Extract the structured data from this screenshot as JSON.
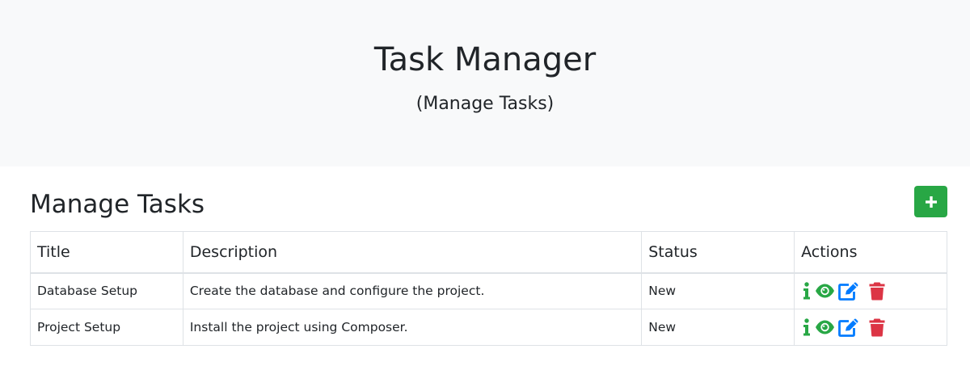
{
  "header": {
    "title": "Task Manager",
    "subtitle": "(Manage Tasks)"
  },
  "main": {
    "section_title": "Manage Tasks",
    "add_button_icon": "plus-icon"
  },
  "table": {
    "columns": [
      "Title",
      "Description",
      "Status",
      "Actions"
    ],
    "rows": [
      {
        "title": "Database Setup",
        "description": "Create the database and configure the project.",
        "status": "New"
      },
      {
        "title": "Project Setup",
        "description": "Install the project using Composer.",
        "status": "New"
      }
    ],
    "action_icons": [
      "info-icon",
      "eye-icon",
      "edit-icon",
      "trash-icon"
    ]
  },
  "colors": {
    "success": "#28a745",
    "primary": "#007bff",
    "danger": "#dc3545",
    "hero_bg": "#f8f9fa",
    "border": "#dee2e6"
  }
}
